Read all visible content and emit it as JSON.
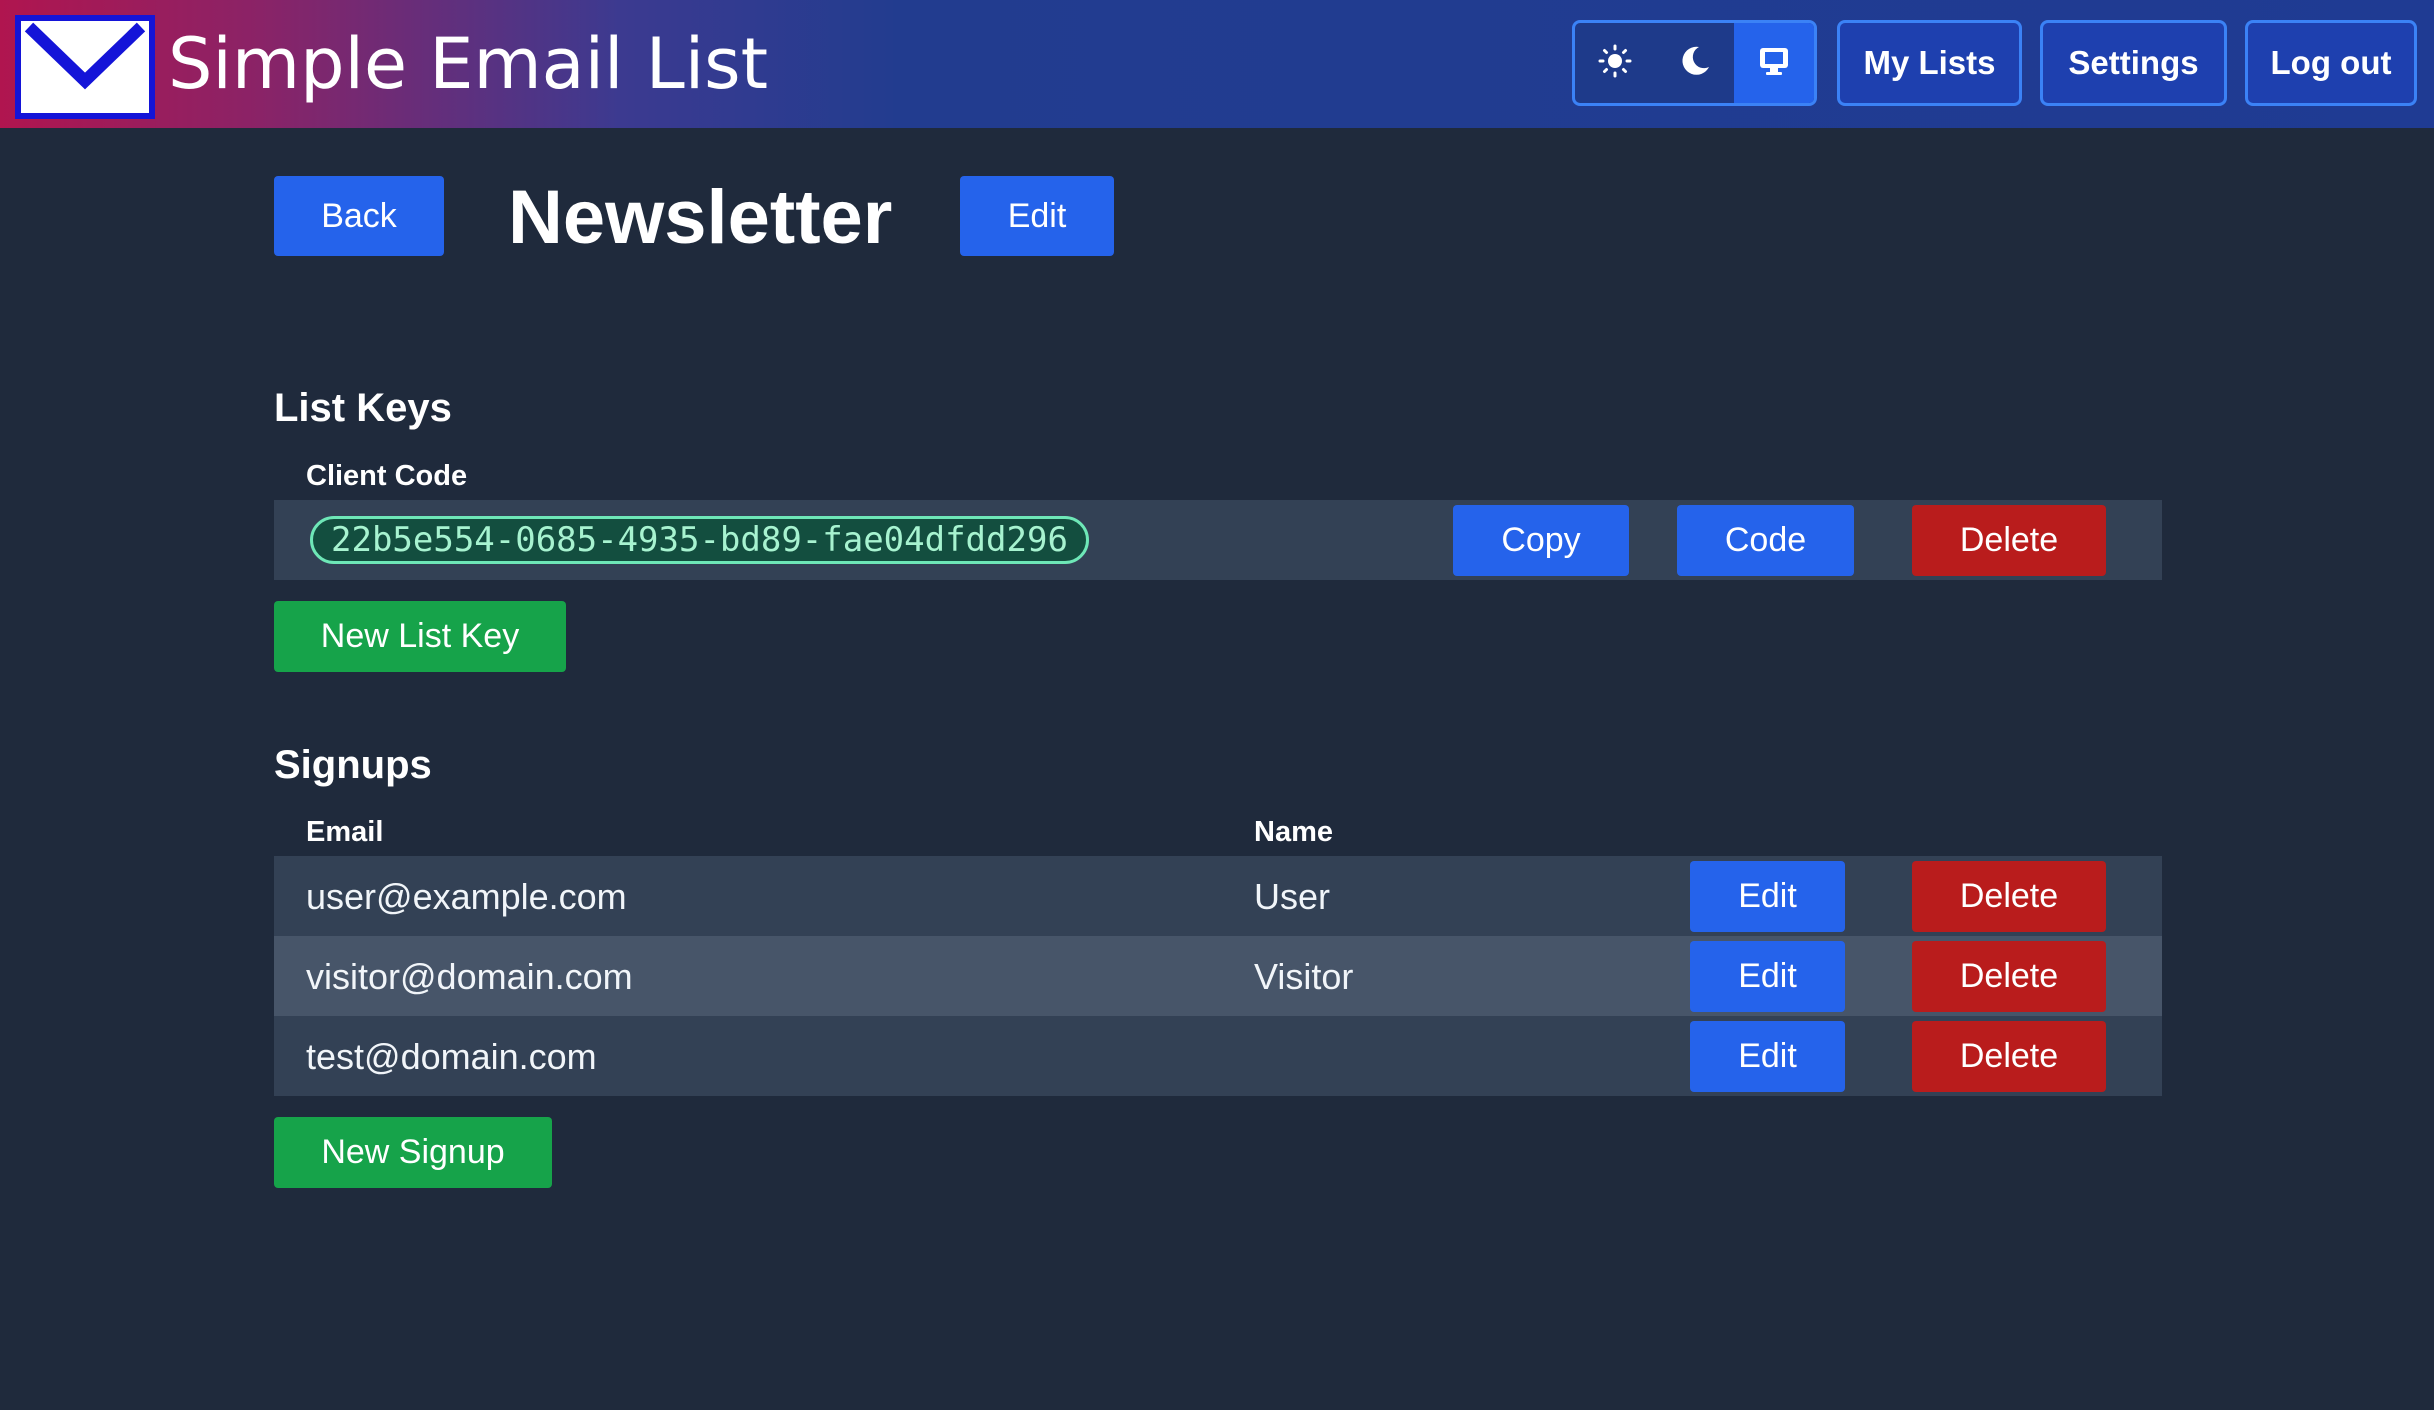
{
  "header": {
    "app_title": "Simple Email List",
    "nav": {
      "my_lists": "My Lists",
      "settings": "Settings",
      "logout": "Log out"
    },
    "theme_options": [
      "sun-icon",
      "moon-icon",
      "monitor-icon"
    ],
    "theme_selected": "monitor-icon"
  },
  "page": {
    "back_label": "Back",
    "title": "Newsletter",
    "edit_label": "Edit"
  },
  "list_keys": {
    "heading": "List Keys",
    "column_header": "Client Code",
    "keys": [
      {
        "code": "22b5e554-0685-4935-bd89-fae04dfdd296",
        "copy_label": "Copy",
        "code_label": "Code",
        "delete_label": "Delete"
      }
    ],
    "new_label": "New List Key"
  },
  "signups": {
    "heading": "Signups",
    "columns": [
      "Email",
      "Name"
    ],
    "rows": [
      {
        "email": "user@example.com",
        "name": "User",
        "edit_label": "Edit",
        "delete_label": "Delete"
      },
      {
        "email": "visitor@domain.com",
        "name": "Visitor",
        "edit_label": "Edit",
        "delete_label": "Delete"
      },
      {
        "email": "test@domain.com",
        "name": "",
        "edit_label": "Edit",
        "delete_label": "Delete"
      }
    ],
    "new_label": "New Signup"
  },
  "colors": {
    "background": "#1f2a3c",
    "primary": "#2563eb",
    "danger": "#b91c1c",
    "success": "#16a34a",
    "key_pill_border": "#6ee7b7"
  }
}
